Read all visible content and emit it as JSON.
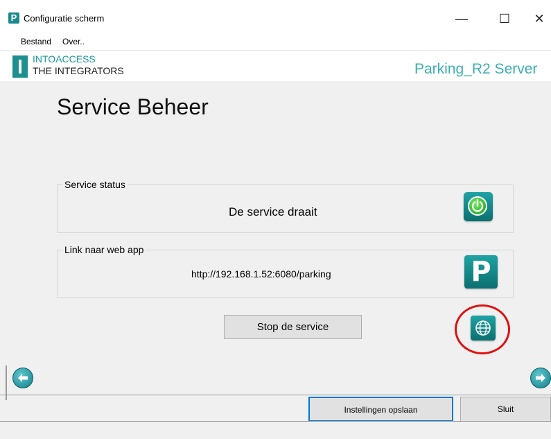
{
  "window": {
    "title": "Configuratie scherm",
    "app_icon_letter": "P",
    "minimize_glyph": "—",
    "maximize_glyph": "☐",
    "close_glyph": "✕"
  },
  "menu": {
    "items": [
      "Bestand",
      "Over.."
    ]
  },
  "header": {
    "brand_line1": "INTOACCESS",
    "brand_line2": "THE INTEGRATORS",
    "product_name": "Parking_R2 Server"
  },
  "page": {
    "title": "Service Beheer"
  },
  "service_status": {
    "group_title": "Service status",
    "status_text": "De service draait"
  },
  "web_app": {
    "group_title": "Link naar web app",
    "url": "http://192.168.1.52:6080/parking",
    "tile_letter": "P"
  },
  "actions": {
    "stop_service_label": "Stop de service",
    "save_label": "Instellingen opslaan",
    "close_label": "Sluit"
  },
  "icons": {
    "power": "power-icon",
    "parking": "parking-icon",
    "globe": "globe-icon",
    "back": "arrow-left-icon",
    "forward": "arrow-right-icon"
  },
  "colors": {
    "accent": "#1c8f8e",
    "highlight_circle": "#e01010",
    "power_green": "#2ecc40"
  }
}
